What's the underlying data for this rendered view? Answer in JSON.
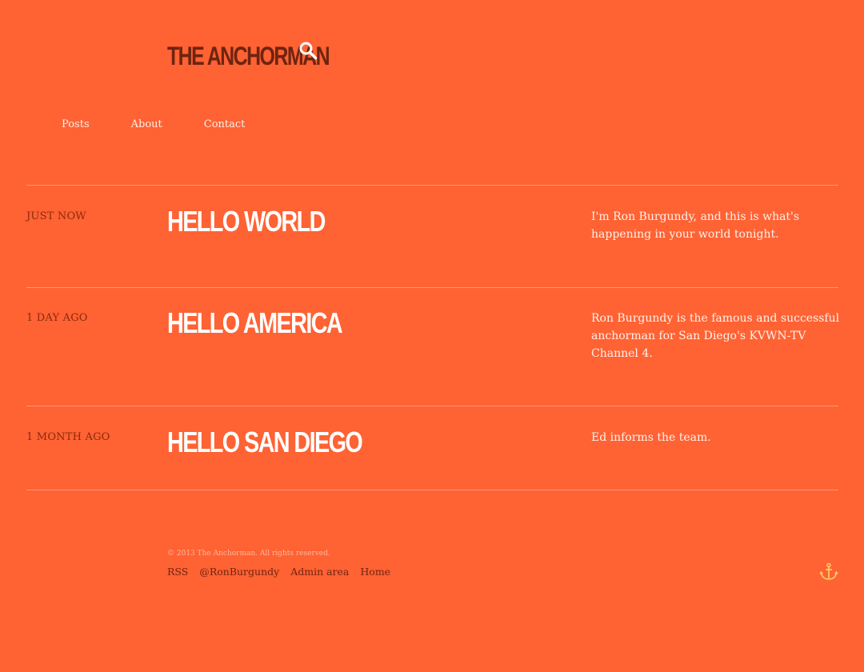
{
  "header": {
    "site_title": "THE ANCHORMAN",
    "search_icon": "search-icon"
  },
  "nav": {
    "items": [
      {
        "label": "Posts"
      },
      {
        "label": "About"
      },
      {
        "label": "Contact"
      }
    ]
  },
  "posts": [
    {
      "date": "JUST NOW",
      "title": "HELLO WORLD",
      "excerpt": "I'm Ron Burgundy, and this is what's happening in your world tonight."
    },
    {
      "date": "1 DAY AGO",
      "title": "HELLO AMERICA",
      "excerpt": "Ron Burgundy is the famous and successful anchorman for San Diego's KVWN-TV Channel 4."
    },
    {
      "date": "1 MONTH AGO",
      "title": "HELLO SAN DIEGO",
      "excerpt": "Ed informs the team."
    }
  ],
  "footer": {
    "copyright": "© 2013 The Anchorman. All rights reserved.",
    "links": [
      {
        "label": "RSS"
      },
      {
        "label": "@RonBurgundy"
      },
      {
        "label": "Admin area"
      },
      {
        "label": "Home"
      }
    ],
    "anchor_icon": "anchor-icon"
  },
  "colors": {
    "background": "#ff6233",
    "title_dark": "#6e2410",
    "text_light": "#fff1ea"
  }
}
